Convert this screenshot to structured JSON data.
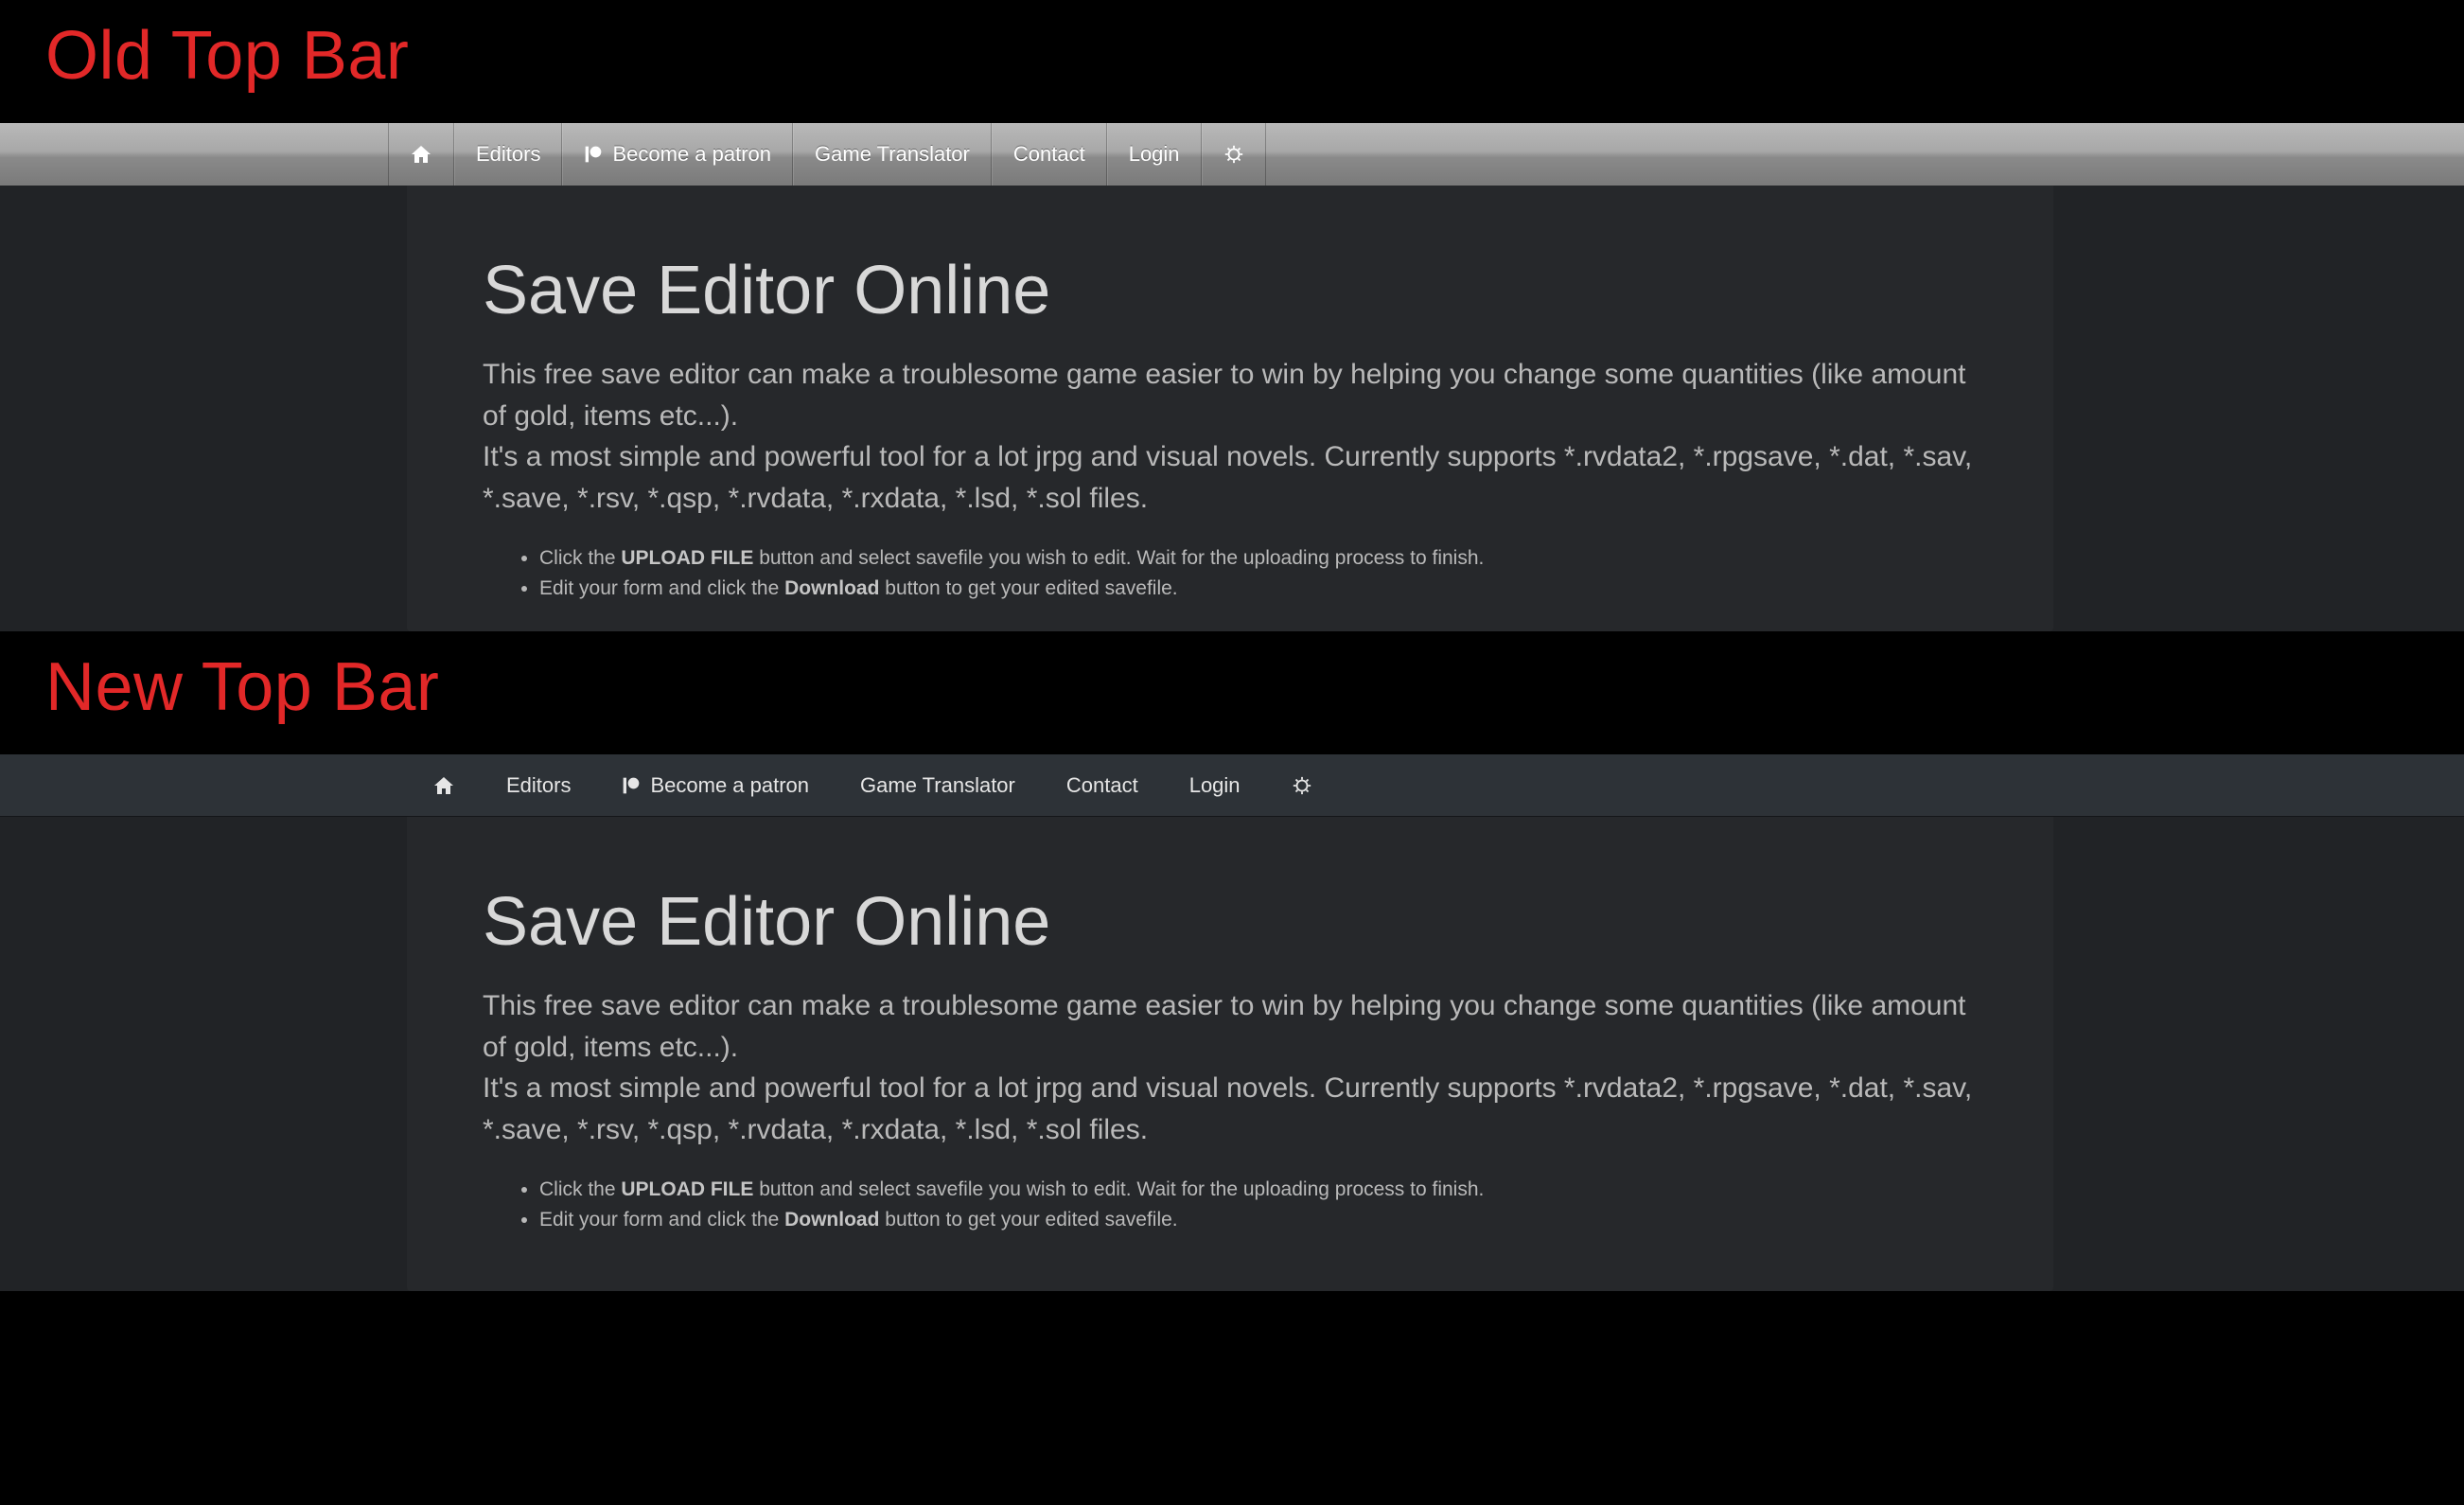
{
  "labels": {
    "old": "Old Top Bar",
    "new": "New Top Bar"
  },
  "nav": {
    "editors": "Editors",
    "become_patron": "Become a patron",
    "game_translator": "Game Translator",
    "contact": "Contact",
    "login": "Login"
  },
  "content": {
    "title": "Save Editor Online",
    "desc_line1": "This free save editor can make a troublesome game easier to win by helping you change some quantities (like amount of gold, items etc...).",
    "desc_line2": "It's a most simple and powerful tool for a lot jrpg and visual novels. Currently supports *.rvdata2, *.rpgsave, *.dat, *.sav, *.save, *.rsv, *.qsp, *.rvdata, *.rxdata, *.lsd, *.sol files.",
    "step1_pre": "Click the ",
    "step1_bold": "UPLOAD FILE",
    "step1_post": " button and select savefile you wish to edit. Wait for the uploading process to finish.",
    "step2_pre": "Edit your form and click the ",
    "step2_bold": "Download",
    "step2_post": " button to get your edited savefile."
  }
}
